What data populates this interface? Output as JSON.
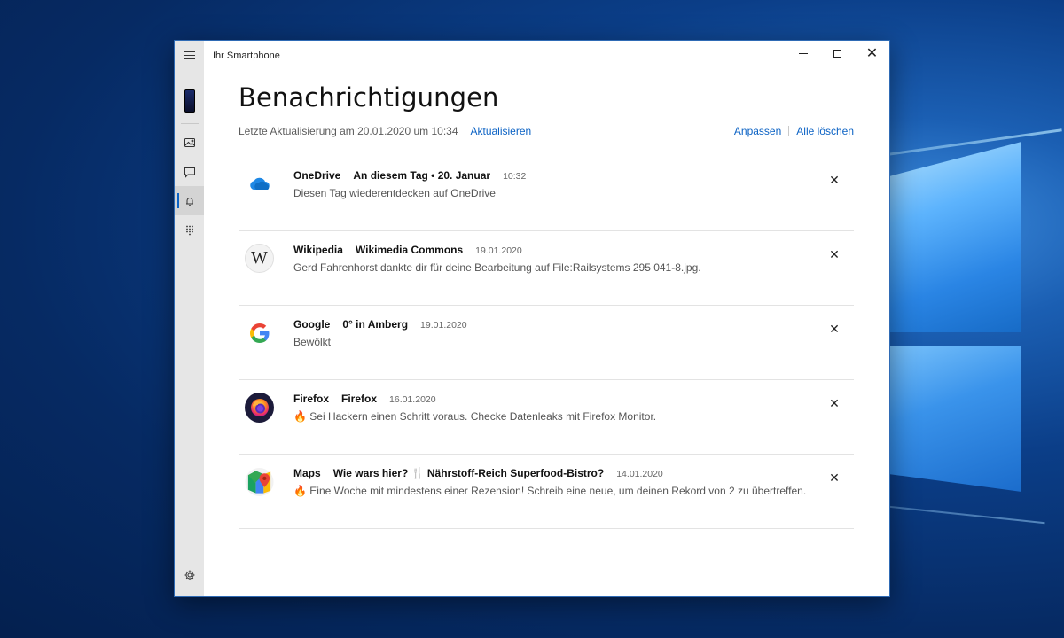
{
  "window": {
    "title": "Ihr Smartphone",
    "controls": {
      "minimize": "minimize-icon",
      "maximize": "maximize-icon",
      "close": "✕"
    }
  },
  "sidebar": {
    "items": [
      {
        "name": "photos",
        "icon": "photos-icon"
      },
      {
        "name": "messages",
        "icon": "message-icon"
      },
      {
        "name": "notifications",
        "icon": "bell-icon",
        "active": true
      },
      {
        "name": "calls",
        "icon": "dialpad-icon"
      }
    ],
    "settings_icon": "gear-icon"
  },
  "page": {
    "title": "Benachrichtigungen",
    "last_update": "Letzte Aktualisierung am 20.01.2020 um 10:34",
    "refresh_label": "Aktualisieren",
    "customize_label": "Anpassen",
    "clear_all_label": "Alle löschen"
  },
  "notifications": [
    {
      "app": "OneDrive",
      "subject": "An diesem Tag • 20. Januar",
      "time": "10:32",
      "body": "Diesen Tag wiederentdecken auf OneDrive",
      "icon": "onedrive-icon",
      "dismiss": "✕"
    },
    {
      "app": "Wikipedia",
      "subject": "Wikimedia Commons",
      "time": "19.01.2020",
      "body": "Gerd Fahrenhorst dankte dir für deine Bearbeitung auf File:Railsystems 295 041-8.jpg.",
      "icon": "wikipedia-icon",
      "icon_glyph": "W",
      "dismiss": "✕"
    },
    {
      "app": "Google",
      "subject": "0° in Amberg",
      "time": "19.01.2020",
      "body": "Bewölkt",
      "icon": "google-icon",
      "dismiss": "✕"
    },
    {
      "app": "Firefox",
      "subject": "Firefox",
      "time": "16.01.2020",
      "body": "🔥 Sei Hackern einen Schritt voraus. Checke Datenleaks mit Firefox Monitor.",
      "icon": "firefox-icon",
      "dismiss": "✕"
    },
    {
      "app": "Maps",
      "subject": "Wie wars hier? 🍴 Nährstoff-Reich Superfood-Bistro?",
      "time": "14.01.2020",
      "body": "🔥 Eine Woche mit mindestens einer Rezension! Schreib eine neue, um deinen Rekord von 2 zu übertreffen.",
      "icon": "google-maps-icon",
      "dismiss": "✕"
    }
  ]
}
